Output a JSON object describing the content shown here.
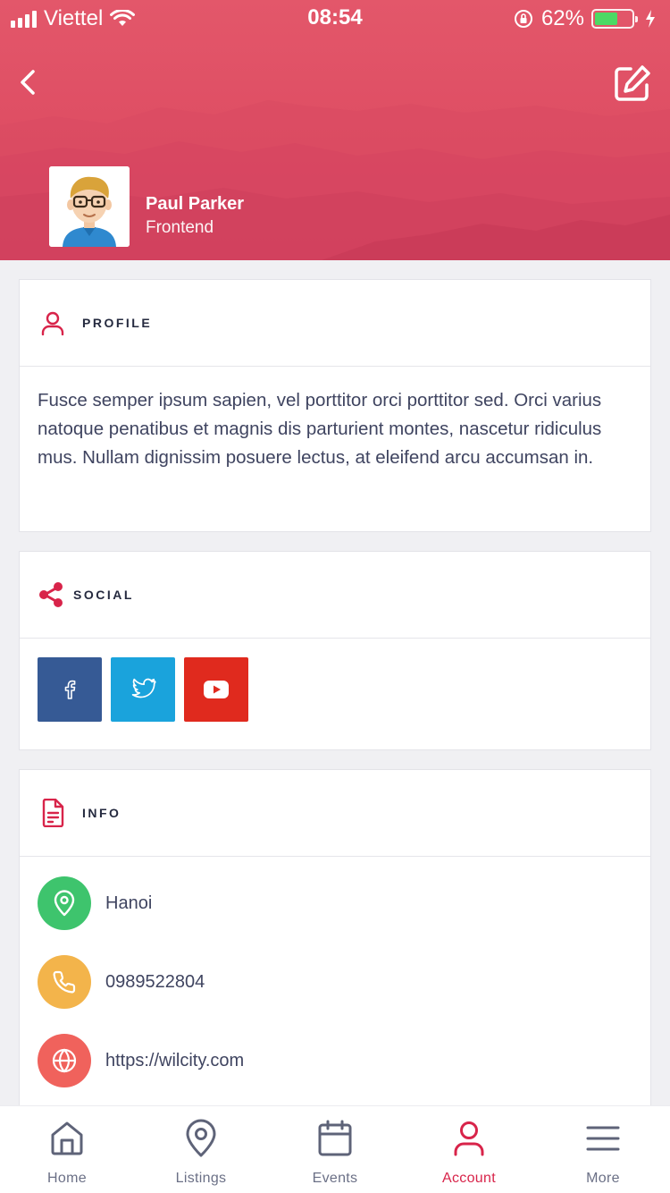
{
  "status_bar": {
    "carrier": "Viettel",
    "time": "08:54",
    "battery_percent": "62%",
    "battery_level": 0.62
  },
  "header": {
    "user_name": "Paul Parker",
    "user_role": "Frontend",
    "colors": {
      "brand": "#de4d63"
    }
  },
  "profile": {
    "title": "PROFILE",
    "text": "Fusce semper ipsum sapien, vel porttitor orci porttitor sed. Orci varius natoque penatibus et magnis dis parturient montes, nascetur ridiculus mus. Nullam dignissim posuere lectus, at eleifend arcu accumsan in."
  },
  "social": {
    "title": "SOCIAL",
    "links": [
      {
        "icon": "facebook-icon",
        "color": "#365a95"
      },
      {
        "icon": "twitter-icon",
        "color": "#1aa3dc"
      },
      {
        "icon": "youtube-icon",
        "color": "#e02a1e"
      }
    ]
  },
  "info": {
    "title": "INFO",
    "items": [
      {
        "icon": "location-pin-icon",
        "color": "#3ec46d",
        "value": "Hanoi"
      },
      {
        "icon": "phone-icon",
        "color": "#f3b44b",
        "value": "0989522804"
      },
      {
        "icon": "globe-icon",
        "color": "#f0625c",
        "value": "https://wilcity.com"
      }
    ]
  },
  "tabbar": {
    "active": "Account",
    "accent_color": "#d8244a",
    "tabs": [
      {
        "label": "Home",
        "icon": "home-icon"
      },
      {
        "label": "Listings",
        "icon": "map-pin-icon"
      },
      {
        "label": "Events",
        "icon": "calendar-icon"
      },
      {
        "label": "Account",
        "icon": "user-icon"
      },
      {
        "label": "More",
        "icon": "menu-icon"
      }
    ]
  }
}
